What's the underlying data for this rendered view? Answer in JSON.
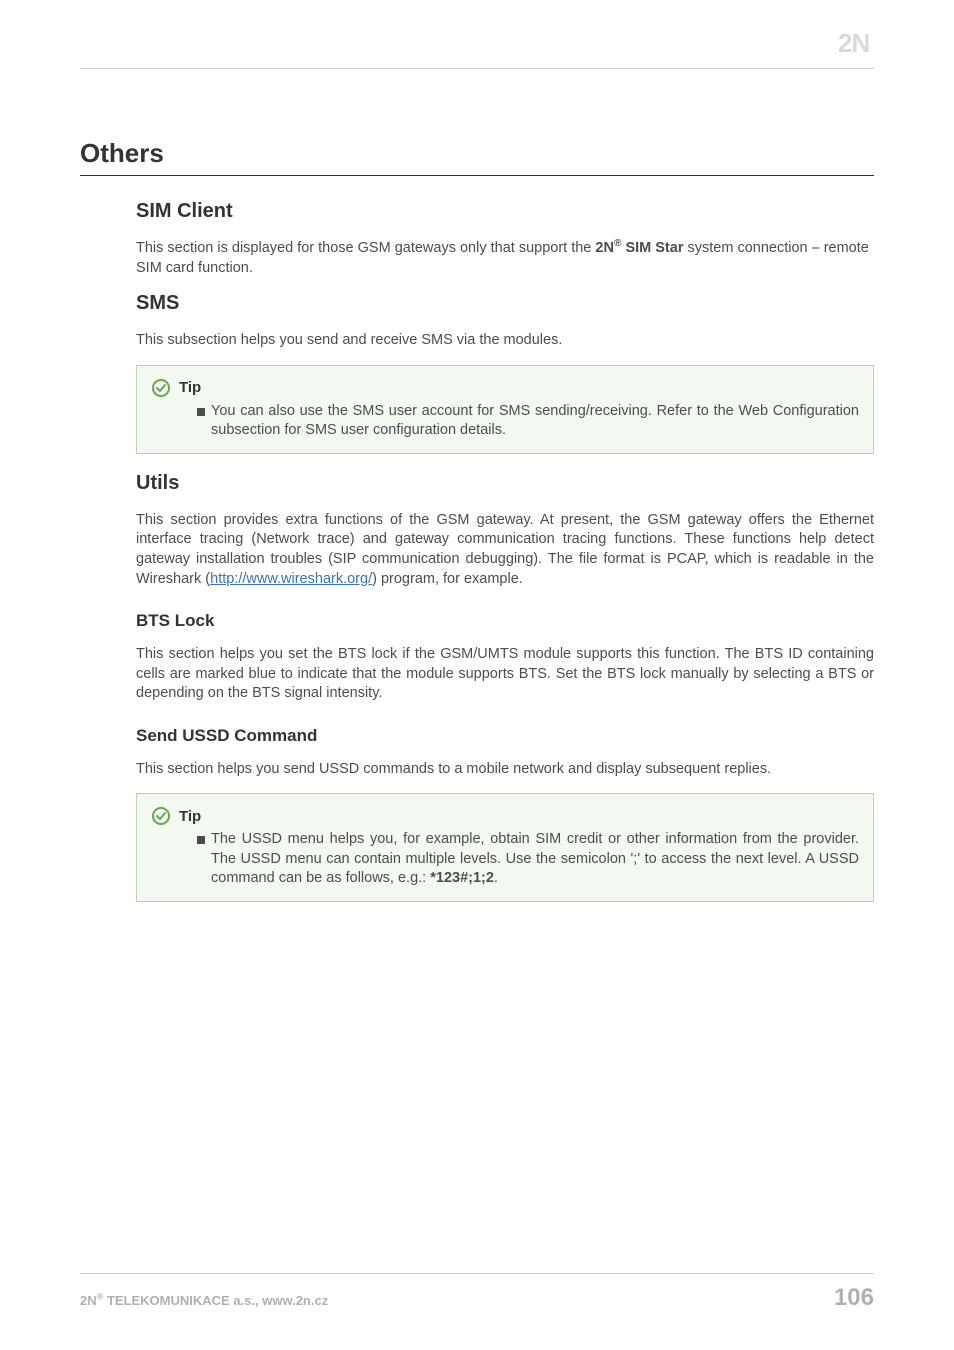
{
  "logo_text": "2N",
  "h1": "Others",
  "sim_client": {
    "heading": "SIM Client",
    "p_pre": "This section is displayed for those GSM gateways only that support the ",
    "p_b": "2N",
    "p_b2": " SIM Star",
    "p_post": " system connection – remote SIM card function."
  },
  "sms": {
    "heading": "SMS",
    "p": "This subsection helps you send and receive SMS via the modules.",
    "tip_title": "Tip",
    "tip_text": "You can also use the SMS user account for SMS sending/receiving. Refer to the Web Configuration subsection for SMS user configuration details."
  },
  "utils": {
    "heading": "Utils",
    "p_pre": "This section provides extra functions of the GSM gateway. At present, the GSM gateway offers the Ethernet interface tracing (Network trace) and gateway communication tracing functions. These functions help detect gateway installation troubles (SIP communication debugging). The file format is PCAP, which is readable in the Wireshark (",
    "link_text": "http://www.wireshark.org/",
    "p_post": ") program, for example."
  },
  "bts": {
    "heading": "BTS Lock",
    "p": "This section helps you set the BTS lock if the GSM/UMTS module supports this function. The BTS ID containing cells are marked blue to indicate that the module supports BTS. Set the BTS lock manually by selecting a BTS or depending on the BTS signal intensity."
  },
  "ussd": {
    "heading": "Send USSD Command",
    "p": "This section helps you send USSD commands to a mobile network and display subsequent replies.",
    "tip_title": "Tip",
    "tip_text_pre": "The USSD menu helps you, for example, obtain SIM credit or other information from the provider. The USSD menu can contain multiple levels. Use the semicolon ';' to access the next level. A USSD command can be as follows, e.g.: ",
    "tip_text_bold": "*123#;1;2",
    "tip_text_post": "."
  },
  "footer": {
    "left_pre": "2N",
    "left_post": " TELEKOMUNIKACE a.s., www.2n.cz",
    "page_no": "106"
  },
  "colors": {
    "tip_border": "#b6d6a9",
    "tip_bg": "#f3f9f0",
    "link": "#3b73af",
    "tip_icon": "#6aa84f"
  }
}
